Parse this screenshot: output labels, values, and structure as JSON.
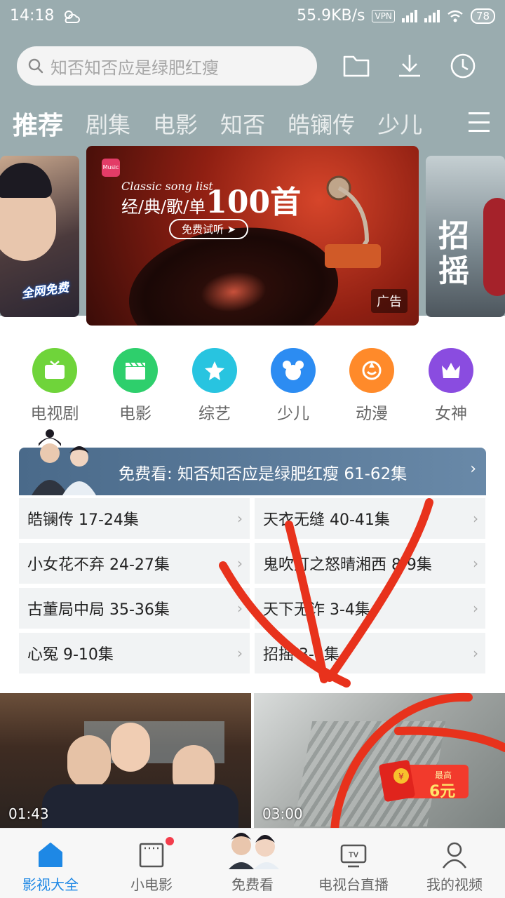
{
  "status_bar": {
    "time": "14:18",
    "network_speed": "55.9KB/s",
    "vpn": "VPN",
    "battery": "78"
  },
  "search": {
    "placeholder": "知否知否应是绿肥红瘦"
  },
  "top_icons": [
    "folder-icon",
    "download-icon",
    "history-icon"
  ],
  "tabs": [
    {
      "label": "推荐",
      "active": true
    },
    {
      "label": "剧集"
    },
    {
      "label": "电影"
    },
    {
      "label": "知否"
    },
    {
      "label": "皓镧传"
    },
    {
      "label": "少儿"
    }
  ],
  "banner": {
    "left_badge": "全网免费",
    "tagline": "Classic song list",
    "title_prefix": "经/典/歌/单",
    "title_number": "100首",
    "button": "免费试听 ➤",
    "logo": "Music",
    "ad_label": "广告",
    "right_text": "招摇"
  },
  "categories": [
    {
      "label": "电视剧",
      "color": "#6fd43a"
    },
    {
      "label": "电影",
      "color": "#2ecf6c"
    },
    {
      "label": "综艺",
      "color": "#28c4e0"
    },
    {
      "label": "少儿",
      "color": "#2c8cf2"
    },
    {
      "label": "动漫",
      "color": "#ff8a2a"
    },
    {
      "label": "女神",
      "color": "#8a4ce0"
    }
  ],
  "free_watch": {
    "title": "免费看: 知否知否应是绿肥红瘦 61-62集",
    "episodes": [
      "皓镧传 17-24集",
      "天衣无缝 40-41集",
      "小女花不弃 24-27集",
      "鬼吹灯之怒晴湘西 8-9集",
      "古董局中局 35-36集",
      "天下无诈 3-4集",
      "心冤 9-10集",
      "招摇 3-4集"
    ]
  },
  "videos": [
    {
      "duration": "01:43"
    },
    {
      "duration": "03:00"
    }
  ],
  "coupon": {
    "label": "最高",
    "amount": "6元"
  },
  "bottom_nav": [
    {
      "label": "影视大全",
      "active": true
    },
    {
      "label": "小电影"
    },
    {
      "label": "免费看"
    },
    {
      "label": "电视台直播"
    },
    {
      "label": "我的视频"
    }
  ],
  "colors": {
    "accent": "#1e88e5",
    "header_bg": "#9aacaf",
    "annotation": "#e8321c"
  }
}
